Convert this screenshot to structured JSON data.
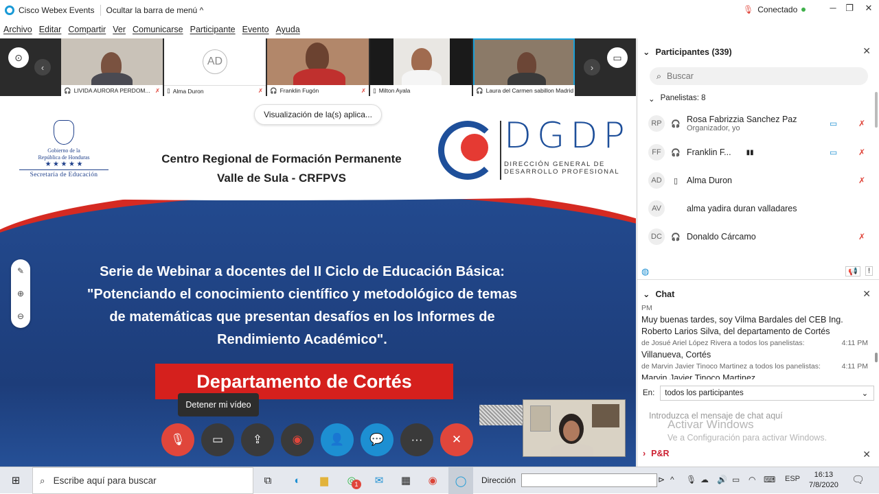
{
  "titlebar": {
    "app_name": "Cisco Webex Events",
    "hide_menu": "Ocultar la barra de menú",
    "status": "Conectado"
  },
  "menu": [
    "Archivo",
    "Editar",
    "Compartir",
    "Ver",
    "Comunicarse",
    "Participante",
    "Evento",
    "Ayuda"
  ],
  "thumbnails": [
    {
      "name": "LIVIDA AURORA PERDOM...",
      "initials": ""
    },
    {
      "name": "Alma Duron",
      "initials": "AD"
    },
    {
      "name": "Franklin Fugón",
      "initials": ""
    },
    {
      "name": "Milton Ayala",
      "initials": ""
    },
    {
      "name": "Laura del Carmen sabillon Madrid",
      "initials": ""
    }
  ],
  "slide": {
    "view_pill": "Visualización de la(s) aplica...",
    "seal_line1": "Gobierno de la",
    "seal_line2": "República de Honduras",
    "seal_stars": "★ ★ ★ ★ ★",
    "seal_secretaria": "Secretaría de Educación",
    "center_title_1": "Centro Regional de Formación Permanente",
    "center_title_2": "Valle de Sula - CRFPVS",
    "logo_text": "DGDP",
    "logo_sub_1": "DIRECCIÓN GENERAL DE",
    "logo_sub_2": "DESARROLLO PROFESIONAL",
    "webinar_1": "Serie de Webinar a docentes del II Ciclo de Educación Básica:",
    "webinar_2": "\"Potenciando el conocimiento científico y metodológico de temas",
    "webinar_3": "de matemáticas que presentan desafíos en los Informes de",
    "webinar_4": "Rendimiento Académico\".",
    "department": "Departamento de Cortés"
  },
  "tooltip": "Detener mi vídeo",
  "colors": {
    "accent": "#1d8fd2",
    "danger": "#e0463b",
    "slide_blue": "#234a8f",
    "slide_red": "#d5201d"
  },
  "participants": {
    "header": "Participantes (339)",
    "search_placeholder": "Buscar",
    "panelists_label": "Panelistas: 8",
    "rows": [
      {
        "initials": "RP",
        "name": "Rosa Fabrizzia Sanchez Paz",
        "sub": "Organizador, yo"
      },
      {
        "initials": "FF",
        "name": "Franklin F...",
        "sub": ""
      },
      {
        "initials": "AD",
        "name": "Alma Duron",
        "sub": ""
      },
      {
        "initials": "AV",
        "name": "alma yadira duran valladares",
        "sub": ""
      },
      {
        "initials": "DC",
        "name": "Donaldo Cárcamo",
        "sub": ""
      }
    ]
  },
  "chat": {
    "header": "Chat",
    "messages": [
      {
        "meta": "PM",
        "time": "",
        "text": "Muy buenas tardes, soy Vilma Bardales del CEB Ing. Roberto Larios Silva, del departamento de Cortés"
      },
      {
        "meta": "de Josué Ariel López Rivera a todos los panelistas:",
        "time": "4:11 PM",
        "text": "Villanueva, Cortés"
      },
      {
        "meta": "de Marvin Javier Tinoco Martinez a todos los panelistas:",
        "time": "4:11 PM",
        "text": "Marvin Javier Tinoco Martinez"
      }
    ],
    "to_label": "En:",
    "to_value": "todos los participantes",
    "input_placeholder": "Introduzca el mensaje de chat aquí",
    "watermark_1": "Activar Windows",
    "watermark_2": "Ve a Configuración para activar Windows."
  },
  "qa": {
    "header": "P&R"
  },
  "taskbar": {
    "search_text": "Escribe aquí para buscar",
    "address_label": "Dirección",
    "language": "ESP",
    "time": "16:13",
    "date": "7/8/2020",
    "badge": "1"
  }
}
